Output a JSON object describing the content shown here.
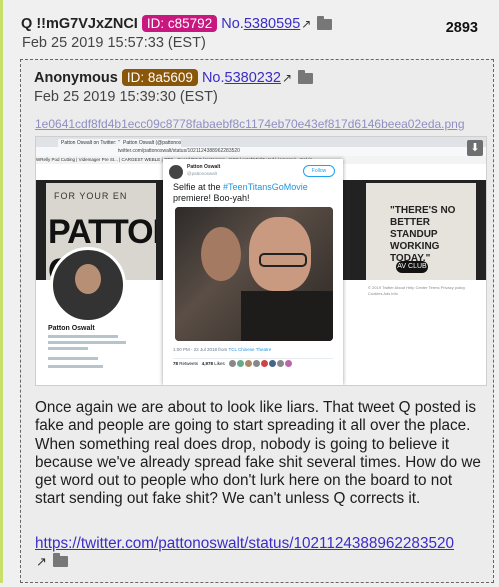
{
  "post": {
    "name": "Q",
    "tripcode": "!!mG7VJxZNCI",
    "id_label": "ID:",
    "id_value": "c85792",
    "id_color": "#c8187f",
    "no_label": "No.",
    "no_value": "5380595",
    "date": "Feb 25 2019 15:57:33 (EST)",
    "count": "2893"
  },
  "quoted": {
    "name": "Anonymous",
    "id_label": "ID:",
    "id_value": "8a5609",
    "id_color": "#8a5609",
    "no_label": "No.",
    "no_value": "5380232",
    "date": "Feb 25 2019 15:39:30 (EST)",
    "filename": "1e0641cdf8fd4b1ecc09c8778fabaebf8c1174eb70e43ef817d6146beea02eda.png",
    "body": "Once again we are about to look like liars. That tweet Q posted is fake and people are going to start spreading it all over the place. When something real does drop, nobody is going to believe it because we've already spread fake shit several times. How do we get word out to people who don't lurk here on the board to not start sending out fake shit? We can't unless Q corrects it.",
    "link": "https://twitter.com/pattonoswalt/status/1021124388962283520"
  },
  "screenshot": {
    "tabs": [
      "Patton Oswalt on Twitter: \"Selfie...",
      "Patton Oswalt (@pattonoswalt)"
    ],
    "address": "twitter.com/pattonoswalt/status/1021124388962283520",
    "bookmarks": "WRelly Pod Cutting  |  Videmager Pre St...  |  CARGEST WEBLE  |  OPS - Guard Pst It  |  Instagram - NSC  |  patchMighty Ind  |  (Amarcy) - Calvin",
    "banner_left_top": "FOR YOUR EN",
    "banner_left_big": "PATTON O",
    "banner_right_text": "\"THERE'S NO BETTER STANDUP WORKING TODAY.\"",
    "banner_right_logo": "AV CLUB",
    "profile_name": "Patton Oswalt",
    "tweet_name": "Patton Oswalt",
    "tweet_handle": "@pattonoswalt",
    "follow": "Follow",
    "tweet_text_1": "Selfie at the ",
    "tweet_hashtag": "#TeenTitansGoMovie",
    "tweet_text_2": " premiere! Boo-yah!",
    "tweet_meta": "1:00 PM - 22 Jul 2018 from ",
    "tweet_location": "TCL Chinese Theatre",
    "retweets": "78",
    "likes": "4,978",
    "right_footer": "© 2019 Twitter  About  Help Center  Terms  Privacy policy  Cookies  Ads info"
  },
  "colors": {
    "link": "#3a2cc7",
    "accent_bar": "#c8e06a"
  }
}
